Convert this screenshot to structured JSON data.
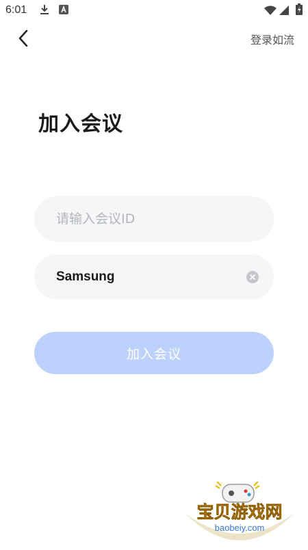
{
  "status_bar": {
    "time": "6:01",
    "icons": [
      "download-icon",
      "a-icon",
      "wifi-icon",
      "signal-icon",
      "battery-icon"
    ]
  },
  "header": {
    "back_icon": "chevron-left-icon",
    "login_label": "登录如流"
  },
  "page": {
    "title": "加入会议"
  },
  "form": {
    "meeting_id": {
      "placeholder": "请输入会议ID",
      "value": ""
    },
    "name": {
      "value": "Samsung",
      "clear_icon": "clear-icon"
    },
    "join_label": "加入会议"
  },
  "watermark": {
    "title": "宝贝游戏网",
    "domain": "baobeiy.com"
  },
  "colors": {
    "accent_disabled": "#bcd2fc",
    "input_bg": "#f5f6f8",
    "placeholder": "#b3b6bc"
  }
}
